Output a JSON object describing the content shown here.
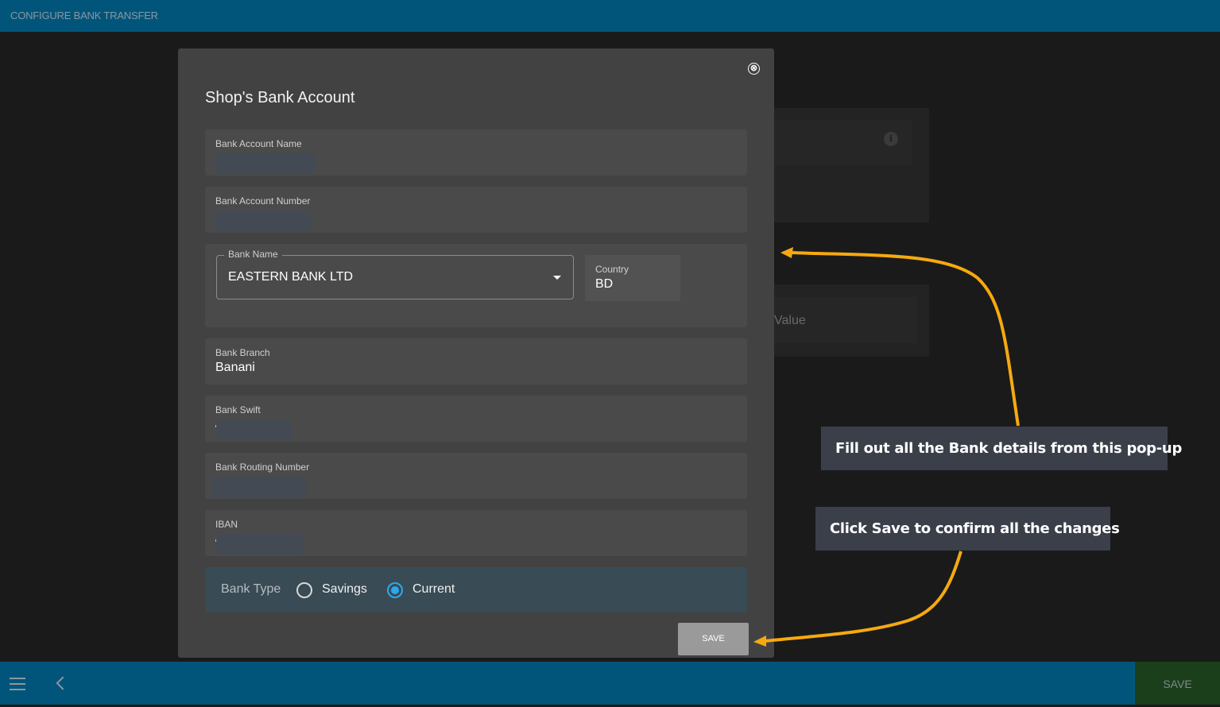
{
  "header": {
    "title": "CONFIGURE BANK TRANSFER"
  },
  "background": {
    "value_placeholder": "Value",
    "info_icon": "i"
  },
  "modal": {
    "title": "Shop's Bank Account",
    "close_icon": "⊗",
    "fields": {
      "account_name": {
        "label": "Bank Account Name",
        "value": ""
      },
      "account_number": {
        "label": "Bank Account Number",
        "value": ""
      },
      "bank_name": {
        "label": "Bank Name",
        "value": "EASTERN BANK LTD"
      },
      "country": {
        "label": "Country",
        "value": "BD"
      },
      "branch": {
        "label": "Bank Branch",
        "value": "Banani"
      },
      "swift": {
        "label": "Bank Swift",
        "value": ""
      },
      "routing": {
        "label": "Bank Routing Number",
        "value": ""
      },
      "iban": {
        "label": "IBAN",
        "value": ""
      }
    },
    "bank_type": {
      "label": "Bank Type",
      "options": [
        "Savings",
        "Current"
      ],
      "selected": "Current"
    },
    "save_label": "SAVE"
  },
  "callouts": {
    "fill_out": "Fill out all the Bank details from this pop-up",
    "click_save": "Click Save to confirm all the changes",
    "arrow_color": "#f6a90f"
  },
  "footer": {
    "save_label": "SAVE"
  }
}
